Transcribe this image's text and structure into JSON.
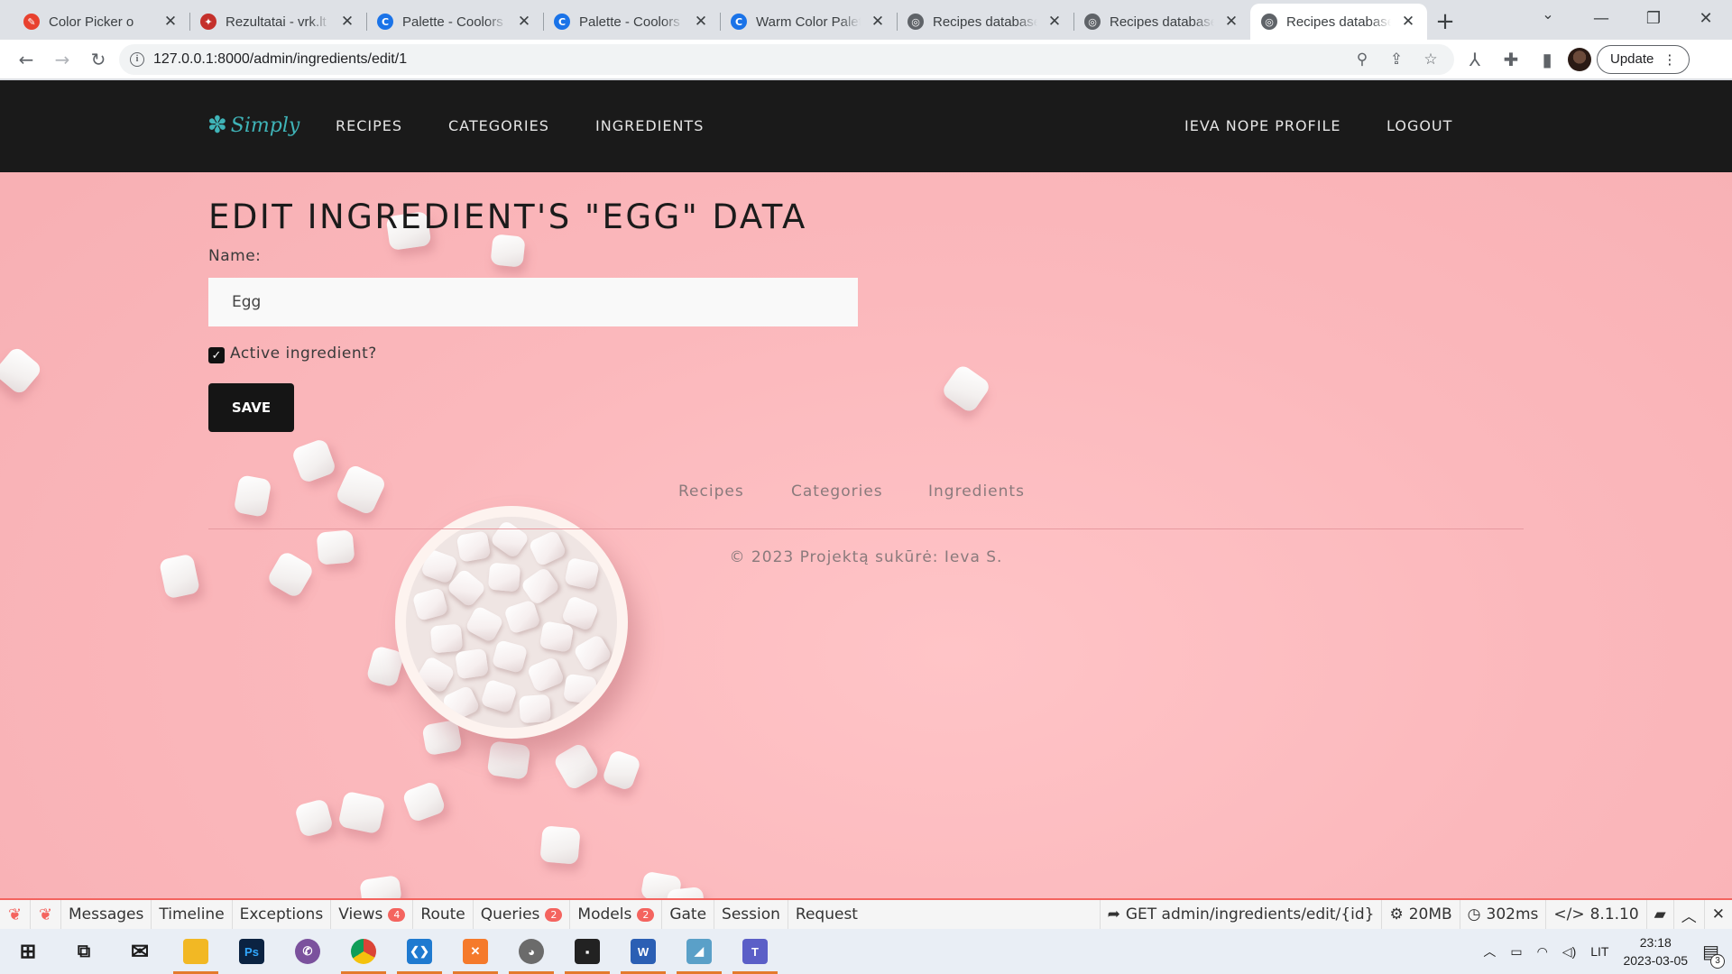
{
  "browser": {
    "tabs": [
      {
        "title": "Color Picker o",
        "favicon_color": "#e8412f",
        "favicon_glyph": "✎"
      },
      {
        "title": "Rezultatai - vrk.lt",
        "favicon_color": "#c4302b",
        "favicon_glyph": "✦"
      },
      {
        "title": "Palette - Coolors",
        "favicon_color": "#1a73e8",
        "favicon_glyph": "C"
      },
      {
        "title": "Palette - Coolors",
        "favicon_color": "#1a73e8",
        "favicon_glyph": "C"
      },
      {
        "title": "Warm Color Palet",
        "favicon_color": "#1a73e8",
        "favicon_glyph": "C"
      },
      {
        "title": "Recipes database",
        "favicon_color": "#5f6368",
        "favicon_glyph": "◎"
      },
      {
        "title": "Recipes database",
        "favicon_color": "#5f6368",
        "favicon_glyph": "◎"
      },
      {
        "title": "Recipes database",
        "favicon_color": "#5f6368",
        "favicon_glyph": "◎"
      }
    ],
    "active_tab_index": 7,
    "url": "127.0.0.1:8000/admin/ingredients/edit/1",
    "update_label": "Update"
  },
  "site": {
    "brand_name": "Simply",
    "brand_sub": "RECIPES",
    "nav": {
      "recipes": "RECIPES",
      "categories": "CATEGORIES",
      "ingredients": "INGREDIENTS",
      "profile": "IEVA NOPE PROFILE",
      "logout": "LOGOUT"
    },
    "accent_color": "#3fb4b8"
  },
  "form": {
    "title": "EDIT INGREDIENT'S \"EGG\" DATA",
    "name_label": "Name:",
    "name_value": "Egg",
    "active_label": "Active ingredient?",
    "active_checked": true,
    "save_label": "SAVE"
  },
  "footer": {
    "links": {
      "recipes": "Recipes",
      "categories": "Categories",
      "ingredients": "Ingredients"
    },
    "copyright": "© 2023 Projektą sukūrė: Ieva S."
  },
  "debugbar": {
    "items": {
      "messages": "Messages",
      "timeline": "Timeline",
      "exceptions": "Exceptions",
      "views": "Views",
      "views_count": "4",
      "route": "Route",
      "queries": "Queries",
      "queries_count": "2",
      "models": "Models",
      "models_count": "2",
      "gate": "Gate",
      "session": "Session",
      "request": "Request"
    },
    "route_info": "GET admin/ingredients/edit/{id}",
    "memory": "20MB",
    "time": "302ms",
    "php_version": "8.1.10",
    "accent_color": "#f4645f"
  },
  "taskbar": {
    "apps": [
      {
        "name": "start",
        "glyph": "⊞",
        "color": "#1b1b1b"
      },
      {
        "name": "task-view",
        "glyph": "▭",
        "color": "#1b1b1b"
      },
      {
        "name": "mail",
        "glyph": "✉",
        "color": "#1b1b1b"
      },
      {
        "name": "file-explorer",
        "glyph": "▬",
        "color": "#f2b824"
      },
      {
        "name": "photoshop",
        "glyph": "Ps",
        "color": "#0b2342"
      },
      {
        "name": "viber",
        "glyph": "✆",
        "color": "#7b519d"
      },
      {
        "name": "chrome",
        "glyph": "◉",
        "color": "#dd4b39"
      },
      {
        "name": "vscode",
        "glyph": "❮❯",
        "color": "#1f7ad0"
      },
      {
        "name": "xampp",
        "glyph": "✕",
        "color": "#f57a2b"
      },
      {
        "name": "gimp",
        "glyph": "◕",
        "color": "#6b6b6b"
      },
      {
        "name": "terminal",
        "glyph": "▪",
        "color": "#222222"
      },
      {
        "name": "word",
        "glyph": "W",
        "color": "#2b5fb4"
      },
      {
        "name": "notes",
        "glyph": "◢",
        "color": "#5aa0c8"
      },
      {
        "name": "teams",
        "glyph": "T",
        "color": "#5b5fc7"
      }
    ],
    "language": "LIT",
    "time": "23:18",
    "date": "2023-03-05",
    "notification_count": "3"
  }
}
